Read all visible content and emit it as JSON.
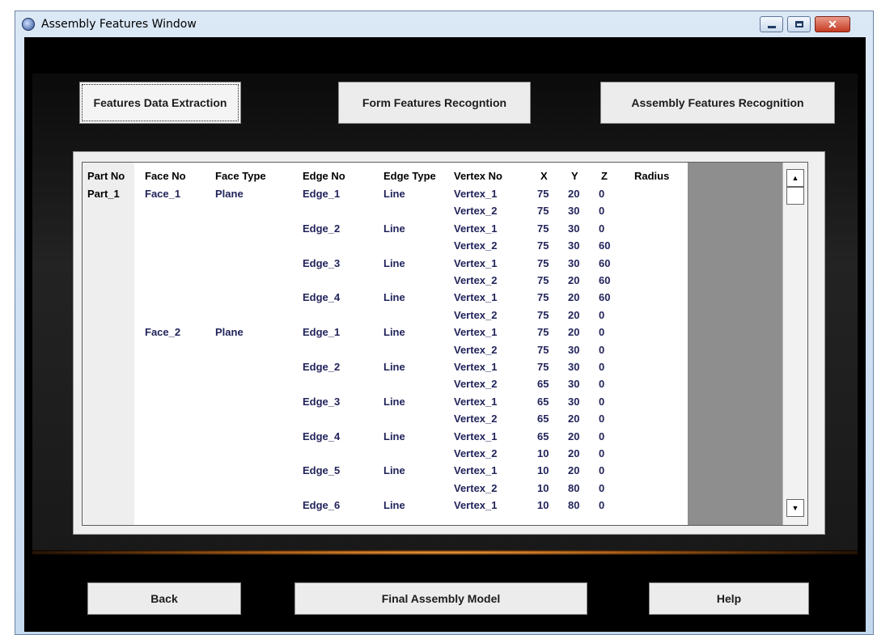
{
  "window": {
    "title": "Assembly Features Window"
  },
  "colors": {
    "accent_glow": "#f3a64a",
    "text_blue": "#22245b",
    "background": "#000000"
  },
  "top_buttons": {
    "extraction": "Features Data Extraction",
    "form_recognition": "Form Features Recogntion",
    "assembly_recognition": "Assembly Features Recognition"
  },
  "table": {
    "headers": {
      "part_no": "Part No",
      "face_no": "Face No",
      "face_type": "Face Type",
      "edge_no": "Edge No",
      "edge_type": "Edge Type",
      "vertex_no": "Vertex No",
      "x": "X",
      "y": "Y",
      "z": "Z",
      "radius": "Radius"
    },
    "rows": [
      {
        "part": "Part_1",
        "face": "Face_1",
        "ftype": "Plane",
        "edge": "Edge_1",
        "etype": "Line",
        "vertex": "Vertex_1",
        "x": "75",
        "y": "20",
        "z": "0",
        "radius": ""
      },
      {
        "part": "",
        "face": "",
        "ftype": "",
        "edge": "",
        "etype": "",
        "vertex": "Vertex_2",
        "x": "75",
        "y": "30",
        "z": "0",
        "radius": ""
      },
      {
        "part": "",
        "face": "",
        "ftype": "",
        "edge": "Edge_2",
        "etype": "Line",
        "vertex": "Vertex_1",
        "x": "75",
        "y": "30",
        "z": "0",
        "radius": ""
      },
      {
        "part": "",
        "face": "",
        "ftype": "",
        "edge": "",
        "etype": "",
        "vertex": "Vertex_2",
        "x": "75",
        "y": "30",
        "z": "60",
        "radius": ""
      },
      {
        "part": "",
        "face": "",
        "ftype": "",
        "edge": "Edge_3",
        "etype": "Line",
        "vertex": "Vertex_1",
        "x": "75",
        "y": "30",
        "z": "60",
        "radius": ""
      },
      {
        "part": "",
        "face": "",
        "ftype": "",
        "edge": "",
        "etype": "",
        "vertex": "Vertex_2",
        "x": "75",
        "y": "20",
        "z": "60",
        "radius": ""
      },
      {
        "part": "",
        "face": "",
        "ftype": "",
        "edge": "Edge_4",
        "etype": "Line",
        "vertex": "Vertex_1",
        "x": "75",
        "y": "20",
        "z": "60",
        "radius": ""
      },
      {
        "part": "",
        "face": "",
        "ftype": "",
        "edge": "",
        "etype": "",
        "vertex": "Vertex_2",
        "x": "75",
        "y": "20",
        "z": "0",
        "radius": ""
      },
      {
        "part": "",
        "face": "Face_2",
        "ftype": "Plane",
        "edge": "Edge_1",
        "etype": "Line",
        "vertex": "Vertex_1",
        "x": "75",
        "y": "20",
        "z": "0",
        "radius": ""
      },
      {
        "part": "",
        "face": "",
        "ftype": "",
        "edge": "",
        "etype": "",
        "vertex": "Vertex_2",
        "x": "75",
        "y": "30",
        "z": "0",
        "radius": ""
      },
      {
        "part": "",
        "face": "",
        "ftype": "",
        "edge": "Edge_2",
        "etype": "Line",
        "vertex": "Vertex_1",
        "x": "75",
        "y": "30",
        "z": "0",
        "radius": ""
      },
      {
        "part": "",
        "face": "",
        "ftype": "",
        "edge": "",
        "etype": "",
        "vertex": "Vertex_2",
        "x": "65",
        "y": "30",
        "z": "0",
        "radius": ""
      },
      {
        "part": "",
        "face": "",
        "ftype": "",
        "edge": "Edge_3",
        "etype": "Line",
        "vertex": "Vertex_1",
        "x": "65",
        "y": "30",
        "z": "0",
        "radius": ""
      },
      {
        "part": "",
        "face": "",
        "ftype": "",
        "edge": "",
        "etype": "",
        "vertex": "Vertex_2",
        "x": "65",
        "y": "20",
        "z": "0",
        "radius": ""
      },
      {
        "part": "",
        "face": "",
        "ftype": "",
        "edge": "Edge_4",
        "etype": "Line",
        "vertex": "Vertex_1",
        "x": "65",
        "y": "20",
        "z": "0",
        "radius": ""
      },
      {
        "part": "",
        "face": "",
        "ftype": "",
        "edge": "",
        "etype": "",
        "vertex": "Vertex_2",
        "x": "10",
        "y": "20",
        "z": "0",
        "radius": ""
      },
      {
        "part": "",
        "face": "",
        "ftype": "",
        "edge": "Edge_5",
        "etype": "Line",
        "vertex": "Vertex_1",
        "x": "10",
        "y": "20",
        "z": "0",
        "radius": ""
      },
      {
        "part": "",
        "face": "",
        "ftype": "",
        "edge": "",
        "etype": "",
        "vertex": "Vertex_2",
        "x": "10",
        "y": "80",
        "z": "0",
        "radius": ""
      },
      {
        "part": "",
        "face": "",
        "ftype": "",
        "edge": "Edge_6",
        "etype": "Line",
        "vertex": "Vertex_1",
        "x": "10",
        "y": "80",
        "z": "0",
        "radius": ""
      }
    ]
  },
  "bottom_buttons": {
    "back": "Back",
    "final_model": "Final Assembly Model",
    "help": "Help"
  }
}
